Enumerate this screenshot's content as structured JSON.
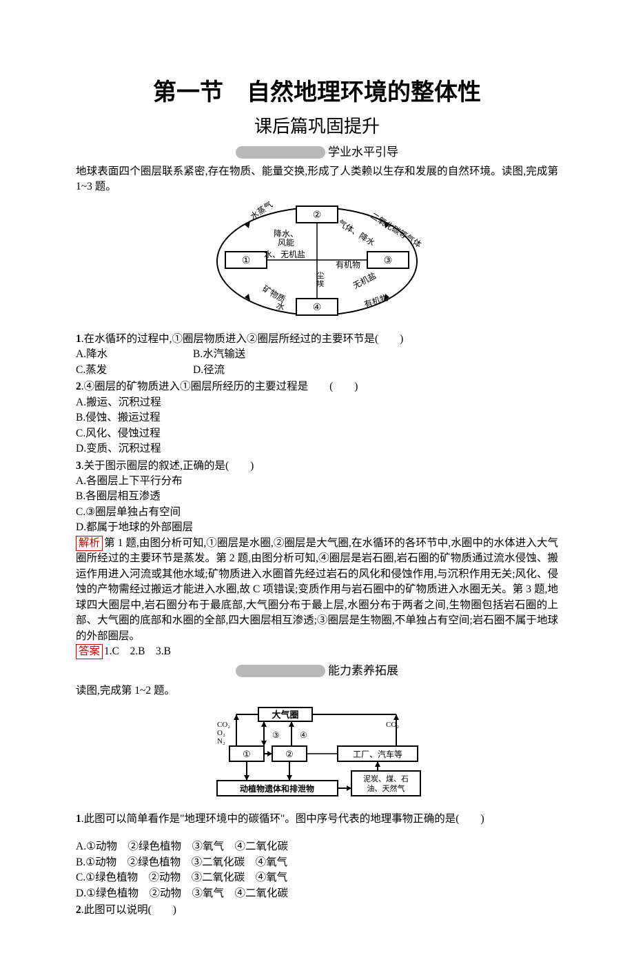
{
  "title": {
    "main": "第一节　自然地理环境的整体性",
    "sub": "课后篇巩固提升"
  },
  "section1": {
    "header": "学业水平引导",
    "intro": "地球表面四个圈层联系紧密,存在物质、能量交换,形成了人类赖以生存和发展的自然环境。读图,完成第 1~3 题。",
    "diagram": {
      "label_steam": "水蒸气",
      "label_precip": "降水、风能",
      "label_co2gas": "二氧化碳等气体",
      "label_gasrain": "气体、降水",
      "label_water_salt": "水、无机盐",
      "label_organic": "有机物",
      "label_dust": "尘埃",
      "label_nosalt": "无机盐",
      "label_minerals": "矿物质",
      "label_water": "水",
      "label_organic2": "有机物",
      "node1": "①",
      "node2": "②",
      "node3": "③",
      "node4": "④"
    },
    "q1": {
      "stem_prefix": "1",
      "stem": ".在水循环的过程中,①圈层物质进入②圈层所经过的主要环节是(　　)",
      "a": "A.降水",
      "b": "B.水汽输送",
      "c": "C.蒸发",
      "d": "D.径流"
    },
    "q2": {
      "stem_prefix": "2",
      "stem": ".④圈层的矿物质进入①圈层所经历的主要过程是　　(　　)",
      "a": "A.搬运、沉积过程",
      "b": "B.侵蚀、搬运过程",
      "c": "C.风化、侵蚀过程",
      "d": "D.变质、沉积过程"
    },
    "q3": {
      "stem_prefix": "3",
      "stem": ".关于图示圈层的叙述,正确的是(　　)",
      "a": "A.各圈层上下平行分布",
      "b": "B.各圈层相互渗透",
      "c": "C.③圈层单独占有空间",
      "d": "D.都属于地球的外部圈层"
    },
    "analysis_label": "解析",
    "analysis": "第 1 题,由图分析可知,①圈层是水圈,②圈层是大气圈,在水循环的各环节中,水圈中的水体进入大气圈所经过的主要环节是蒸发。第 2 题,由图分析可知,④圈层是岩石圈,岩石圈的矿物质通过流水侵蚀、搬运作用进入河流或其他水域;矿物质进入水圈首先经过岩石的风化和侵蚀作用,与沉积作用无关;风化、侵蚀的产物需经过搬运才能进入水圈,故 C 项错误;变质作用与岩石圈中的矿物质进入水圈无关。第 3 题,地球四大圈层中,岩石圈分布于最底部,大气圈分布于最上层,水圈分布于两者之间,生物圈包括岩石圈的上部、大气圈的底部和水圈的全部,四大圈层相互渗透;③圈层是生物圈,不单独占有空间;岩石圈不属于地球的外部圈层。",
    "answer_label": "答案",
    "answer": "1.C　2.B　3.B"
  },
  "section2": {
    "header": "能力素养拓展",
    "intro": "读图,完成第 1~2 题。",
    "diagram": {
      "top": "大气圈",
      "left_labels": "CO₂\nO₂\nN₂",
      "right_label": "CO₂",
      "n1": "①",
      "n2": "②",
      "n3": "③",
      "n4": "④",
      "factory": "工厂、汽车等",
      "bottom_left": "动植物遗体和排泄物",
      "bottom_right": "泥炭、煤、石油、天然气"
    },
    "q1": {
      "stem_prefix": "1",
      "stem": ".此图可以简单看作是\"地理环境中的碳循环\"。图中序号代表的地理事物正确的是(　　)",
      "a": "A.①动物　②绿色植物　③氧气　④二氧化碳",
      "b": "B.①动物　②绿色植物　③二氧化碳　④氧气",
      "c": "C.①绿色植物　②动物　③二氧化碳　④氧气",
      "d": "D.①绿色植物　②动物　③氧气　④二氧化碳"
    },
    "q2": {
      "stem_prefix": "2",
      "stem": ".此图可以说明(　　)"
    }
  }
}
